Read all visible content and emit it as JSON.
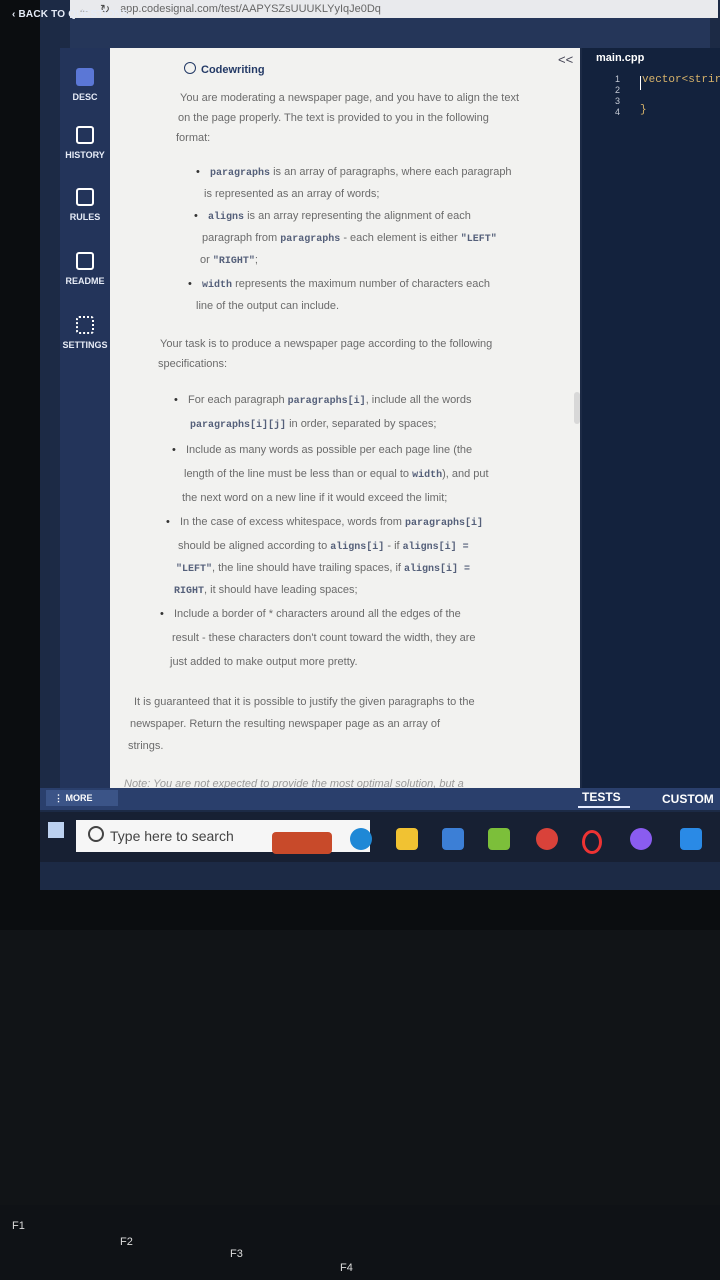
{
  "browser": {
    "url": "app.codesignal.com/test/AAPYSZsUUUKLYyIqJe0Dq"
  },
  "header": {
    "back_label": "BACK TO QUESTIONS"
  },
  "sidebar": {
    "items": [
      {
        "label": "DESC"
      },
      {
        "label": "HISTORY"
      },
      {
        "label": "RULES"
      },
      {
        "label": "README"
      },
      {
        "label": "SETTINGS"
      }
    ]
  },
  "panel": {
    "title": "Codewriting",
    "collapse": "<<",
    "intro1": "You are moderating a newspaper page, and you have to align the text",
    "intro2": "on the page properly. The text is provided to you in the following",
    "intro3": "format:",
    "b1a_code": "paragraphs",
    "b1a": " is an array of paragraphs, where each paragraph",
    "b1b": "is represented as an array of words;",
    "b2a_code": "aligns",
    "b2a": " is an array representing the alignment of each",
    "b2b_prefix": "paragraph from ",
    "b2b_code": "paragraphs",
    "b2b_mid": " - each element is either ",
    "b2b_code2": "\"LEFT\"",
    "b2c_prefix": "or ",
    "b2c_code": "\"RIGHT\"",
    "b2c_suffix": ";",
    "b3a_code": "width",
    "b3a": " represents the maximum number of characters each",
    "b3b": "line of the output can include.",
    "task1": "Your task is to produce a newspaper page according to the following",
    "task2": "specifications:",
    "s1a_prefix": "For each paragraph ",
    "s1a_code": "paragraphs[i]",
    "s1a_suffix": ", include all the words",
    "s1b_code": "paragraphs[i][j]",
    "s1b_suffix": " in order, separated by spaces;",
    "s2a": "Include as many words as possible per each page line (the",
    "s2b_prefix": "length of the line must be less than or equal to ",
    "s2b_code": "width",
    "s2b_suffix": "), and put",
    "s2c": "the next word on a new line if it would exceed the limit;",
    "s3a_prefix": "In the case of excess whitespace, words from ",
    "s3a_code": "paragraphs[i]",
    "s3b_prefix": "should be aligned according to ",
    "s3b_code": "aligns[i]",
    "s3b_mid": " - if ",
    "s3b_code2": "aligns[i] =",
    "s3c_code": "\"LEFT\"",
    "s3c_mid": ", the line should have trailing spaces, if ",
    "s3c_code2": "aligns[i] =",
    "s3d_code": "RIGHT",
    "s3d_suffix": ", it should have leading spaces;",
    "s4a": "Include a border of * characters around all the edges of the",
    "s4b": "result - these characters don't count toward the width, they are",
    "s4c": "just added to make output more pretty.",
    "g1": "It is guaranteed that it is possible to justify the given paragraphs to the",
    "g2": "newspaper. Return the resulting newspaper page as an array of",
    "g3": "strings.",
    "note": "Note: You are not expected to provide the most optimal solution, but a"
  },
  "editor": {
    "file_tab": "main.cpp",
    "line_numbers": [
      "1",
      "2",
      "3",
      "4"
    ],
    "line1": "vector<strir",
    "line3": "}"
  },
  "bottom": {
    "more": "⋮ MORE",
    "tests": "TESTS",
    "custom": "CUSTOM"
  },
  "taskbar": {
    "search_text": "Type here to search"
  },
  "keyboard": {
    "keys": [
      "F1",
      "F2",
      "F3",
      "F4"
    ]
  }
}
